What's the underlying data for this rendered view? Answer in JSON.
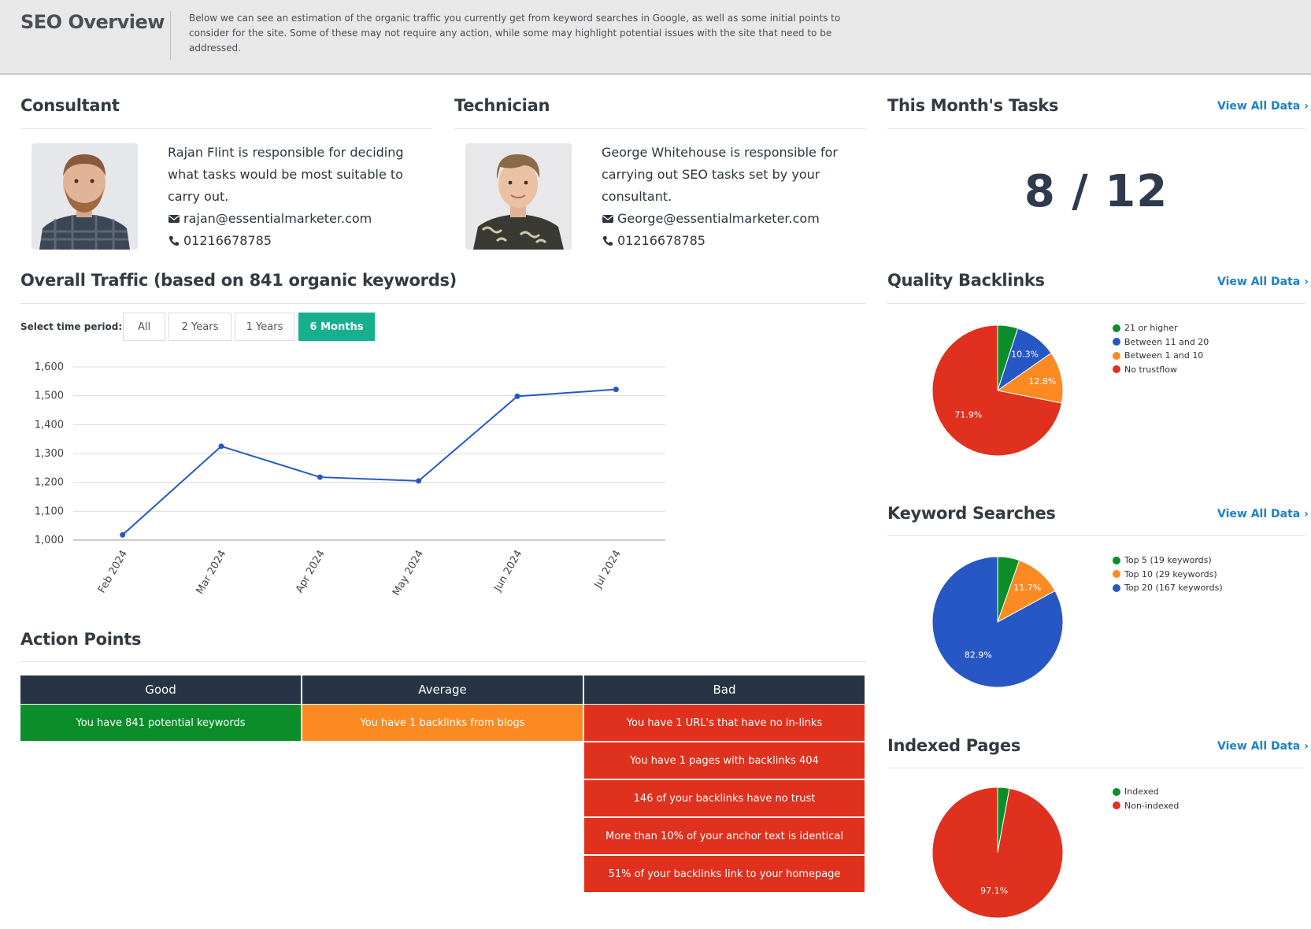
{
  "header": {
    "title": "SEO Overview",
    "description": "Below we can see an estimation of the organic traffic you currently get from keyword searches in Google, as well as some initial points to consider for the site. Some of these may not require any action, while some may highlight potential issues with the site that need to be addressed."
  },
  "consultant": {
    "heading": "Consultant",
    "description_lines": [
      "Rajan Flint is responsible for deciding",
      "what tasks would be most suitable to",
      "carry out."
    ],
    "email": "rajan@essentialmarketer.com",
    "phone": "01216678785"
  },
  "technician": {
    "heading": "Technician",
    "description_lines": [
      "George Whitehouse is responsible for",
      "carrying out SEO tasks set by your",
      "consultant."
    ],
    "email": "George@essentialmarketer.com",
    "phone": "01216678785"
  },
  "tasks": {
    "heading": "This Month's Tasks",
    "view_all": "View All Data",
    "value": "8 / 12"
  },
  "traffic": {
    "heading": "Overall Traffic (based on 841 organic keywords)",
    "period_label": "Select time period:",
    "periods": [
      "All",
      "2 Years",
      "1 Years",
      "6 Months"
    ],
    "active_period": "6 Months"
  },
  "quality_backlinks": {
    "heading": "Quality Backlinks",
    "view_all": "View All Data"
  },
  "keyword_searches": {
    "heading": "Keyword Searches",
    "view_all": "View All Data"
  },
  "indexed_pages": {
    "heading": "Indexed Pages",
    "view_all": "View All Data"
  },
  "action_points": {
    "heading": "Action Points",
    "columns": [
      "Good",
      "Average",
      "Bad"
    ],
    "good": [
      "You have 841 potential keywords"
    ],
    "average": [
      "You have 1 backlinks from blogs"
    ],
    "bad": [
      "You have 1 URL's that have no in-links",
      "You have 1 pages with backlinks 404",
      "146 of your backlinks have no trust",
      "More than 10% of your anchor text is identical",
      "51% of your backlinks link to your homepage"
    ]
  },
  "colors": {
    "green": "#0b8e2a",
    "blue": "#2757c4",
    "orange": "#fb8a23",
    "red": "#e0301e",
    "navy": "#263445",
    "teal": "#16b08e",
    "link": "#1b82c4"
  },
  "icons": {
    "email": "envelope-icon",
    "phone": "phone-icon",
    "view_all": "chevron-right-icon"
  },
  "chart_data": [
    {
      "type": "line",
      "title": "",
      "x": [
        "Feb 2024",
        "Mar 2024",
        "Apr 2024",
        "May 2024",
        "Jun 2024",
        "Jul 2024"
      ],
      "series": [
        {
          "values": [
            1018,
            1325,
            1218,
            1205,
            1498,
            1522
          ]
        }
      ],
      "ylim": [
        1000,
        1600
      ],
      "yticks": [
        "1,000",
        "1,100",
        "1,200",
        "1,300",
        "1,400",
        "1,500",
        "1,600"
      ],
      "grid": true
    },
    {
      "type": "pie",
      "title": "Quality Backlinks",
      "slices": [
        {
          "label": "21 or higher",
          "value": 5.0,
          "color": "#0b8e2a"
        },
        {
          "label": "Between 11 and 20",
          "value": 10.3,
          "color": "#2757c4",
          "display": "10.3%"
        },
        {
          "label": "Between 1 and 10",
          "value": 12.8,
          "color": "#fb8a23",
          "display": "12.8%"
        },
        {
          "label": "No trustflow",
          "value": 71.9,
          "color": "#e0301e",
          "display": "71.9%"
        }
      ],
      "legend": "right"
    },
    {
      "type": "pie",
      "title": "Keyword Searches",
      "slices": [
        {
          "label": "Top 5 (19 keywords)",
          "value": 5.4,
          "color": "#0b8e2a"
        },
        {
          "label": "Top 10 (29 keywords)",
          "value": 11.7,
          "color": "#fb8a23",
          "display": "11.7%"
        },
        {
          "label": "Top 20 (167 keywords)",
          "value": 82.9,
          "color": "#2757c4",
          "display": "82.9%"
        }
      ],
      "legend": "right"
    },
    {
      "type": "pie",
      "title": "Indexed Pages",
      "slices": [
        {
          "label": "Indexed",
          "value": 2.9,
          "color": "#0b8e2a"
        },
        {
          "label": "Non-indexed",
          "value": 97.1,
          "color": "#e0301e",
          "display": "97.1%"
        }
      ],
      "legend": "right"
    }
  ]
}
